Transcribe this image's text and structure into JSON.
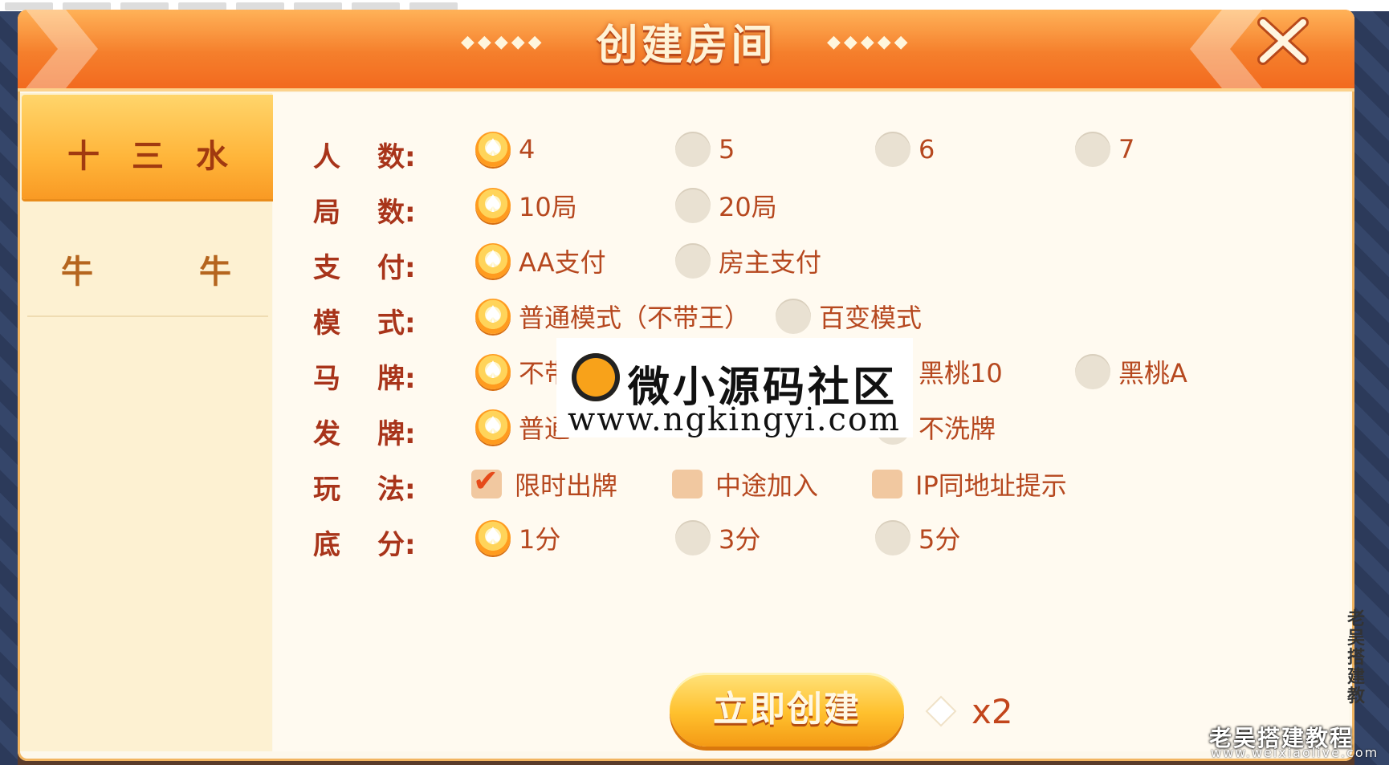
{
  "header": {
    "title": "创建房间",
    "deco_left": "◆◆◆◆◆",
    "deco_right": "◆◆◆◆◆"
  },
  "sidebar": {
    "tabs": [
      {
        "label": "十三水",
        "active": true
      },
      {
        "label": "牛牛",
        "active": false
      }
    ]
  },
  "rows": [
    {
      "label_1": "人",
      "label_2": "数:",
      "options": [
        {
          "text": "4",
          "selected": true
        },
        {
          "text": "5",
          "selected": false
        },
        {
          "text": "6",
          "selected": false
        },
        {
          "text": "7",
          "selected": false
        }
      ]
    },
    {
      "label_1": "局",
      "label_2": "数:",
      "options": [
        {
          "text": "10局",
          "selected": true
        },
        {
          "text": "20局",
          "selected": false
        }
      ]
    },
    {
      "label_1": "支",
      "label_2": "付:",
      "options": [
        {
          "text": "AA支付",
          "selected": true
        },
        {
          "text": "房主支付",
          "selected": false
        }
      ]
    },
    {
      "label_1": "模",
      "label_2": "式:",
      "options": [
        {
          "text": "普通模式（不带王）",
          "selected": true
        },
        {
          "text": "百变模式",
          "selected": false
        }
      ]
    },
    {
      "label_1": "马",
      "label_2": "牌:",
      "options": [
        {
          "text": "不带",
          "selected": true
        },
        {
          "text": "黑桃10",
          "selected": false
        },
        {
          "text": "黑桃A",
          "selected": false
        }
      ]
    },
    {
      "label_1": "发",
      "label_2": "牌:",
      "options": [
        {
          "text": "普通",
          "selected": true
        },
        {
          "text": "不洗牌",
          "selected": false
        }
      ]
    },
    {
      "label_1": "玩",
      "label_2": "法:",
      "options": [
        {
          "text": "限时出牌",
          "checked": true
        },
        {
          "text": "中途加入",
          "checked": false
        },
        {
          "text": "IP同地址提示",
          "checked": false
        }
      ]
    },
    {
      "label_1": "底",
      "label_2": "分:",
      "options": [
        {
          "text": "1分",
          "selected": true
        },
        {
          "text": "3分",
          "selected": false
        },
        {
          "text": "5分",
          "selected": false
        }
      ]
    }
  ],
  "footer": {
    "create_label": "立即创建",
    "cost": "x2"
  },
  "watermark": {
    "title": "微小源码社区",
    "url": "www.ngkingyi.com"
  },
  "signature": {
    "name": "老吴搭建教程",
    "url": "www.weixiaolive.com",
    "vertical": "老吴搭建教"
  },
  "colors": {
    "accent": "#f57f2c",
    "label": "#a8341a",
    "option": "#b6481f",
    "panel": "#fdf8ec"
  }
}
